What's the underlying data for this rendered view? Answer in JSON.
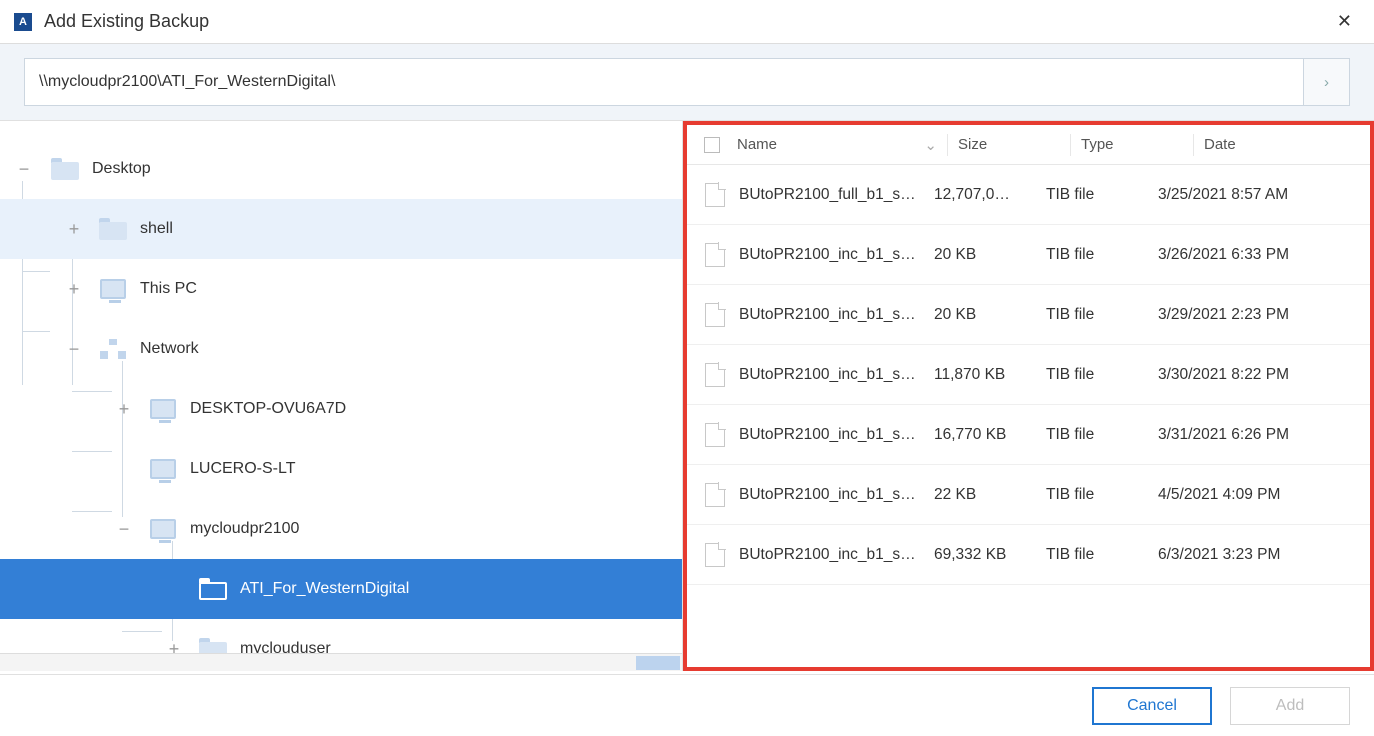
{
  "dialog": {
    "app_icon_letter": "A",
    "title": "Add Existing Backup",
    "close_glyph": "✕"
  },
  "path": {
    "value": "\\\\mycloudpr2100\\ATI_For_WesternDigital\\",
    "go_glyph": "›"
  },
  "tree": {
    "desktop": "Desktop",
    "shell": "shell",
    "this_pc": "This PC",
    "network": "Network",
    "node_desktop1": "DESKTOP-OVU6A7D",
    "node_lucero": "LUCERO-S-LT",
    "node_mycloud": "mycloudpr2100",
    "node_ati": "ATI_For_WesternDigital",
    "node_user": "myclouduser",
    "collapse": "−",
    "expand": "+"
  },
  "columns": {
    "name": "Name",
    "size": "Size",
    "type": "Type",
    "date": "Date",
    "sort_glyph": "⌄"
  },
  "files": [
    {
      "name": "BUtoPR2100_full_b1_s…",
      "size": "12,707,0…",
      "type": "TIB file",
      "date": "3/25/2021 8:57 AM"
    },
    {
      "name": "BUtoPR2100_inc_b1_s…",
      "size": "20 KB",
      "type": "TIB file",
      "date": "3/26/2021 6:33 PM"
    },
    {
      "name": "BUtoPR2100_inc_b1_s…",
      "size": "20 KB",
      "type": "TIB file",
      "date": "3/29/2021 2:23 PM"
    },
    {
      "name": "BUtoPR2100_inc_b1_s…",
      "size": "11,870 KB",
      "type": "TIB file",
      "date": "3/30/2021 8:22 PM"
    },
    {
      "name": "BUtoPR2100_inc_b1_s…",
      "size": "16,770 KB",
      "type": "TIB file",
      "date": "3/31/2021 6:26 PM"
    },
    {
      "name": "BUtoPR2100_inc_b1_s…",
      "size": "22 KB",
      "type": "TIB file",
      "date": "4/5/2021 4:09 PM"
    },
    {
      "name": "BUtoPR2100_inc_b1_s…",
      "size": "69,332 KB",
      "type": "TIB file",
      "date": "6/3/2021 3:23 PM"
    }
  ],
  "buttons": {
    "cancel": "Cancel",
    "add": "Add"
  }
}
